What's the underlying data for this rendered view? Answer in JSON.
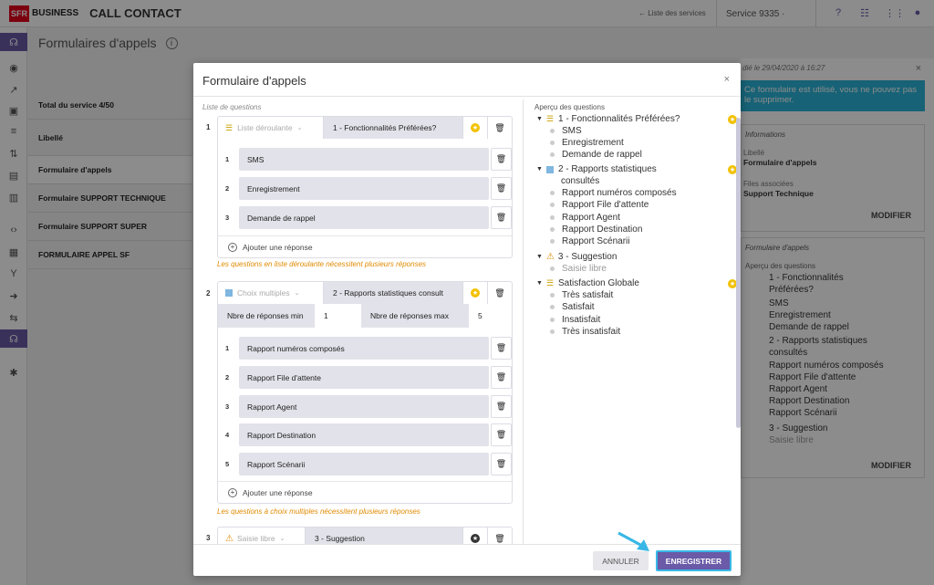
{
  "header": {
    "brand": "SFR",
    "business": "BUSINESS",
    "title": "CALL CONTACT",
    "services_link": "← Liste des services",
    "service": "Service 9335 ·"
  },
  "page": {
    "title": "Formulaires d'appels",
    "help_icon": "info-circle-icon"
  },
  "list": {
    "total": "Total du service 4/50",
    "label": "Libellé",
    "items": [
      "Formulaire d'appels",
      "Formulaire SUPPORT TECHNIQUE",
      "Formulaire SUPPORT SUPER",
      "FORMULAIRE APPEL SF"
    ]
  },
  "modal": {
    "title": "Formulaire d'appels",
    "questions_label": "Liste de questions",
    "q1": {
      "num": "1",
      "type": "Liste déroulante",
      "title": "1 - Fonctionnalités Préférées?",
      "answers": [
        "SMS",
        "Enregistrement",
        "Demande de rappel"
      ],
      "hint": "Les questions en liste déroulante nécessitent plusieurs réponses"
    },
    "q2": {
      "num": "2",
      "type": "Choix multiples",
      "title": "2 - Rapports statistiques consult",
      "min_label": "Nbre de réponses min",
      "min": "1",
      "max_label": "Nbre de réponses max",
      "max": "5",
      "answers": [
        "Rapport numéros composés",
        "Rapport File d'attente",
        "Rapport Agent",
        "Rapport Destination",
        "Rapport Scénarii"
      ],
      "hint": "Les questions à choix multiples nécessitent plusieurs réponses"
    },
    "q3": {
      "num": "3",
      "type": "Saisie libre",
      "title": "3 - Suggestion"
    },
    "add_answer": "Ajouter une réponse",
    "preview_label": "Aperçu des questions",
    "preview": {
      "p1": "1 - Fonctionnalités Préférées?",
      "p1_items": [
        "SMS",
        "Enregistrement",
        "Demande de rappel"
      ],
      "p2a": "2 - Rapports statistiques",
      "p2b": "consultés",
      "p2_items": [
        "Rapport numéros composés",
        "Rapport File d'attente",
        "Rapport Agent",
        "Rapport Destination",
        "Rapport Scénarii"
      ],
      "p3": "3 - Suggestion",
      "p3_item": "Saisie libre",
      "p4": "Satisfaction Globale",
      "p4_items": [
        "Très satisfait",
        "Satisfait",
        "Insatisfait",
        "Très insatisfait"
      ]
    },
    "cancel": "ANNULER",
    "save": "ENREGISTRER"
  },
  "right_panel": {
    "modified": "dié le 29/04/2020 à 16:27",
    "alert": "Ce formulaire est utilisé, vous ne pouvez pas le supprimer.",
    "info_title": "Informations",
    "libelle_label": "Libellé",
    "libelle_value": "Formulaire d'appels",
    "files_label": "Files associées",
    "files_value": "Support Technique",
    "modify": "MODIFIER",
    "form_title": "Formulaire d'appels",
    "preview_label": "Aperçu des questions",
    "p1a": "1 - Fonctionnalités",
    "p1b": "Préférées?",
    "p2a": "2 - Rapports statistiques",
    "p2b": "consultés",
    "p3": "3 - Suggestion",
    "p3_item": "Saisie libre",
    "modify2": "MODIFIER"
  },
  "colors": {
    "accent": "#6a5aa7",
    "star": "#f2c100",
    "hint": "#e08a00",
    "highlight": "#38b7e6"
  }
}
